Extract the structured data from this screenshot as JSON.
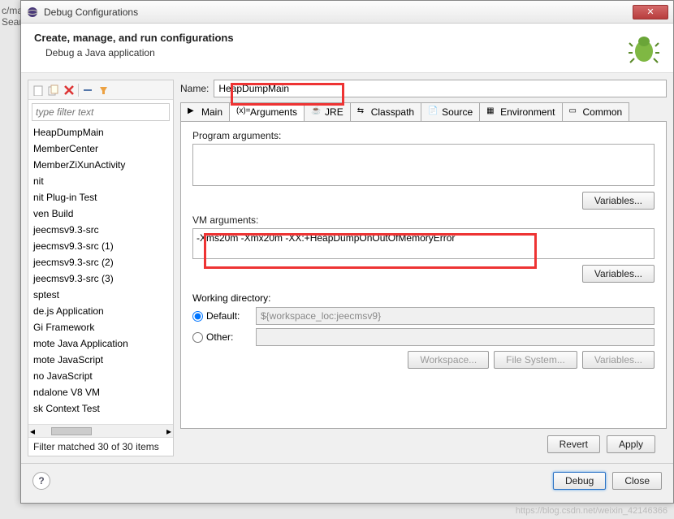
{
  "window": {
    "title": "Debug Configurations"
  },
  "header": {
    "title": "Create, manage, and run configurations",
    "subtitle": "Debug a Java application"
  },
  "filter": {
    "placeholder": "type filter text",
    "status": "Filter matched 30 of 30 items"
  },
  "configList": [
    "HeapDumpMain",
    "MemberCenter",
    "MemberZiXunActivity",
    "nit",
    "nit Plug-in Test",
    "ven Build",
    "jeecmsv9.3-src",
    "jeecmsv9.3-src (1)",
    "jeecmsv9.3-src (2)",
    "jeecmsv9.3-src (3)",
    "sptest",
    "de.js Application",
    "Gi Framework",
    "mote Java Application",
    "mote JavaScript",
    "no JavaScript",
    "ndalone V8 VM",
    "sk Context Test"
  ],
  "nameField": {
    "label": "Name:",
    "value": "HeapDumpMain"
  },
  "tabs": [
    "Main",
    "Arguments",
    "JRE",
    "Classpath",
    "Source",
    "Environment",
    "Common"
  ],
  "arguments": {
    "programLabel": "Program arguments:",
    "programValue": "",
    "vmLabel": "VM arguments:",
    "vmValue": "-Xms20m -Xmx20m -XX:+HeapDumpOnOutOfMemoryError",
    "variablesBtn": "Variables..."
  },
  "workingDir": {
    "label": "Working directory:",
    "defaultLabel": "Default:",
    "defaultValue": "${workspace_loc:jeecmsv9}",
    "otherLabel": "Other:",
    "workspaceBtn": "Workspace...",
    "filesystemBtn": "File System...",
    "variablesBtn": "Variables..."
  },
  "buttons": {
    "revert": "Revert",
    "apply": "Apply",
    "debug": "Debug",
    "close": "Close"
  },
  "watermark": "https://blog.csdn.net/weixin_42146366",
  "bgFragments": {
    "a": "c/mai",
    "b": "Sear"
  }
}
